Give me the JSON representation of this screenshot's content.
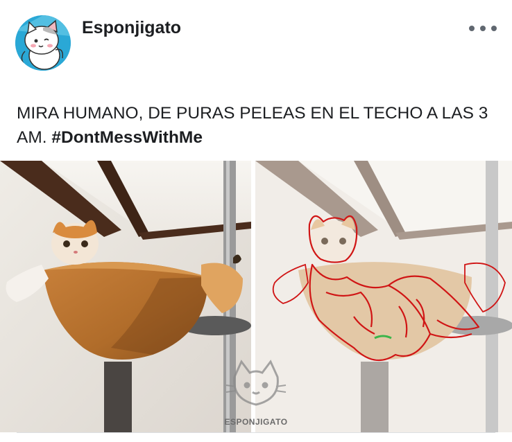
{
  "post": {
    "author": "Esponjigato",
    "caption_text": "MIRA HUMANO, DE PURAS PELEAS EN EL TECHO A LAS 3 AM.",
    "hashtag": "#DontMessWithMe",
    "watermark": "ESPONJIGATO"
  },
  "icons": {
    "more": "more-horizontal-icon",
    "avatar": "cat-avatar"
  },
  "colors": {
    "text": "#1c1e21",
    "muted": "#606770",
    "avatar_bg": "#2aa8d6",
    "sketch_line": "#d01515"
  }
}
